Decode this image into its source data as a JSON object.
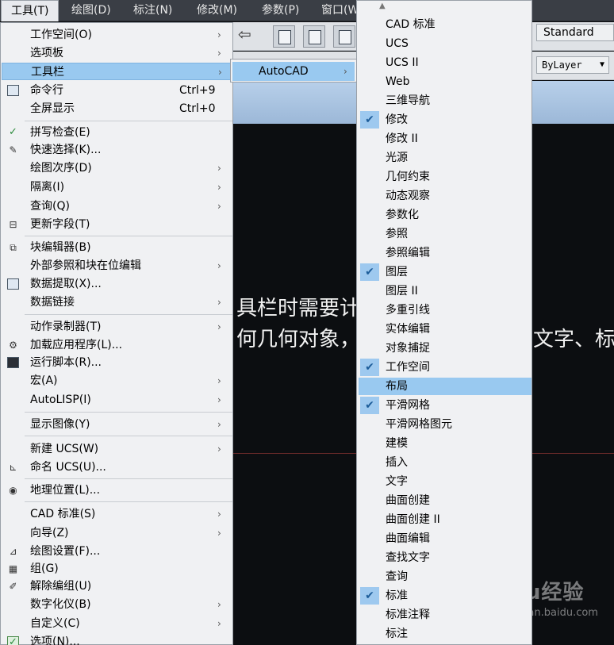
{
  "menubar": [
    {
      "label": "工具(T)",
      "active": true
    },
    {
      "label": "绘图(D)"
    },
    {
      "label": "标注(N)"
    },
    {
      "label": "修改(M)"
    },
    {
      "label": "参数(P)"
    },
    {
      "label": "窗口(W"
    }
  ],
  "toolbar": {
    "style_value": "Standard",
    "layer_value": "ByLayer"
  },
  "canvas_text": {
    "line1": "具栏时需要计",
    "line2a": "何几何对象，",
    "line2b": "文字、标"
  },
  "watermark": {
    "brand": "Baidu经验",
    "url": "jingyan.baidu.com"
  },
  "tools_menu": {
    "items": [
      {
        "label": "工作空间(O)",
        "arrow": true
      },
      {
        "label": "选项板",
        "arrow": true
      },
      {
        "label": "工具栏",
        "arrow": true,
        "highlighted": true
      },
      {
        "label": "命令行",
        "shortcut": "Ctrl+9",
        "icon": "command-line-icon"
      },
      {
        "label": "全屏显示",
        "shortcut": "Ctrl+0"
      },
      {
        "label": "拼写检查(E)",
        "icon": "spell-check-icon"
      },
      {
        "label": "快速选择(K)...",
        "icon": "quick-select-icon"
      },
      {
        "label": "绘图次序(D)",
        "arrow": true
      },
      {
        "label": "隔离(I)",
        "arrow": true
      },
      {
        "label": "查询(Q)",
        "arrow": true
      },
      {
        "label": "更新字段(T)",
        "icon": "update-field-icon"
      },
      {
        "label": "块编辑器(B)",
        "icon": "block-editor-icon"
      },
      {
        "label": "外部参照和块在位编辑",
        "arrow": true
      },
      {
        "label": "数据提取(X)...",
        "icon": "data-extraction-icon"
      },
      {
        "label": "数据链接",
        "arrow": true
      },
      {
        "label": "动作录制器(T)",
        "arrow": true
      },
      {
        "label": "加载应用程序(L)...",
        "icon": "load-application-icon"
      },
      {
        "label": "运行脚本(R)...",
        "icon": "run-script-icon"
      },
      {
        "label": "宏(A)",
        "arrow": true
      },
      {
        "label": "AutoLISP(I)",
        "arrow": true
      },
      {
        "label": "显示图像(Y)",
        "arrow": true
      },
      {
        "label": "新建 UCS(W)",
        "arrow": true
      },
      {
        "label": "命名 UCS(U)...",
        "icon": "named-ucs-icon"
      },
      {
        "label": "地理位置(L)...",
        "icon": "geolocation-icon"
      },
      {
        "label": "CAD 标准(S)",
        "arrow": true
      },
      {
        "label": "向导(Z)",
        "arrow": true
      },
      {
        "label": "绘图设置(F)...",
        "icon": "drafting-settings-icon"
      },
      {
        "label": "组(G)",
        "icon": "group-icon"
      },
      {
        "label": "解除编组(U)",
        "icon": "ungroup-icon"
      },
      {
        "label": "数字化仪(B)",
        "arrow": true
      },
      {
        "label": "自定义(C)",
        "arrow": true
      },
      {
        "label": "选项(N)...",
        "icon": "options-check-icon"
      }
    ]
  },
  "toolbar_submenu": {
    "items": [
      {
        "label": "AutoCAD",
        "arrow": true,
        "highlighted": true
      }
    ]
  },
  "autocad_toolbars": {
    "items": [
      {
        "label": "CAD 标准"
      },
      {
        "label": "UCS"
      },
      {
        "label": "UCS II"
      },
      {
        "label": "Web"
      },
      {
        "label": "三维导航"
      },
      {
        "label": "修改",
        "checked": true
      },
      {
        "label": "修改 II"
      },
      {
        "label": "光源"
      },
      {
        "label": "几何约束"
      },
      {
        "label": "动态观察"
      },
      {
        "label": "参数化"
      },
      {
        "label": "参照"
      },
      {
        "label": "参照编辑"
      },
      {
        "label": "图层",
        "checked": true
      },
      {
        "label": "图层 II"
      },
      {
        "label": "多重引线"
      },
      {
        "label": "实体编辑"
      },
      {
        "label": "对象捕捉"
      },
      {
        "label": "工作空间",
        "checked": true
      },
      {
        "label": "布局",
        "highlighted": true
      },
      {
        "label": "平滑网格",
        "checked": true
      },
      {
        "label": "平滑网格图元"
      },
      {
        "label": "建模"
      },
      {
        "label": "插入"
      },
      {
        "label": "文字"
      },
      {
        "label": "曲面创建"
      },
      {
        "label": "曲面创建 II"
      },
      {
        "label": "曲面编辑"
      },
      {
        "label": "查找文字"
      },
      {
        "label": "查询"
      },
      {
        "label": "标准",
        "checked": true
      },
      {
        "label": "标准注释"
      },
      {
        "label": "标注"
      }
    ]
  },
  "colors": {
    "highlight": "#99c9f0",
    "menu_bg": "#f0f1f3",
    "canvas_bg": "#0c0e11",
    "menubar_bg": "#3a3e45"
  }
}
